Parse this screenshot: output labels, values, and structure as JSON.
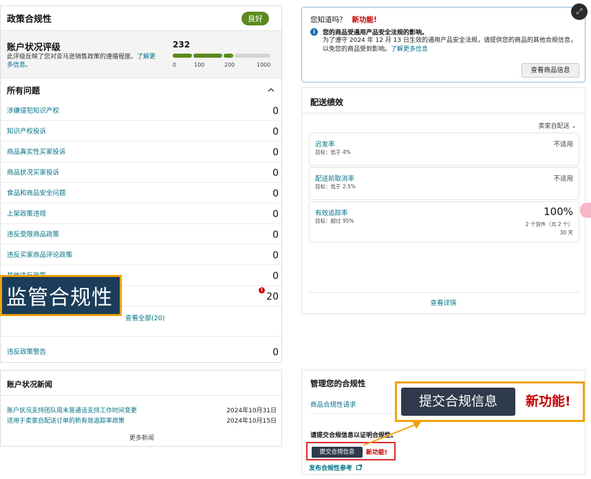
{
  "policy": {
    "title": "政策合规性",
    "badge": "良好",
    "health_title": "账户状况评级",
    "health_desc": "此评级反映了您对亚马逊销售政策的遵循程度。",
    "health_link": "了解更多信息。",
    "score": "232",
    "ticks": [
      "0",
      "100",
      "200",
      "1000"
    ],
    "issues_title": "所有问题",
    "issues": [
      {
        "label": "涉嫌侵犯知识产权",
        "count": "0"
      },
      {
        "label": "知识产权投诉",
        "count": "0"
      },
      {
        "label": "商品真实性买家投诉",
        "count": "0"
      },
      {
        "label": "商品状况买家投诉",
        "count": "0"
      },
      {
        "label": "食品和商品安全问题",
        "count": "0"
      },
      {
        "label": "上架政策违规",
        "count": "0"
      },
      {
        "label": "违反受限商品政策",
        "count": "0"
      },
      {
        "label": "违反买家商品评论政策",
        "count": "0"
      },
      {
        "label": "其他违反政策",
        "count": "0"
      }
    ],
    "regulatory_count": "20",
    "view_all": "查看全部(20)",
    "policy_warning_label": "违反政策警告",
    "policy_warning_count": "0"
  },
  "callout_regulatory": "监管合规性",
  "news": {
    "title": "账户状况新闻",
    "items": [
      {
        "text": "账户状况支持团队周末普通话支持工作时间变更",
        "date": "2024年10月31日"
      },
      {
        "text": "适用于卖家自配送订单的新有效追踪率政策",
        "date": "2024年10月15日"
      }
    ],
    "more": "更多新闻"
  },
  "did_you_know": {
    "title": "您知道吗？",
    "new_label": "新功能!",
    "bold": "您的商品受通用产品安全法规的影响。",
    "text": "为了遵守 2024 年 12 月 13 日生效的通用产品安全法规，请提供您的商品的其他合规信息，以免您的商品受到影响。",
    "link": "了解更多信息",
    "button": "查看商品信息"
  },
  "shipping": {
    "title": "配送绩效",
    "seller_select": "卖家自配送 ⌄",
    "metrics": [
      {
        "name": "迟发率",
        "target": "目标：低于 4%",
        "value": "不适用"
      },
      {
        "name": "配送前取消率",
        "target": "目标：低于 2.5%",
        "value": "不适用"
      },
      {
        "name": "有效追踪率",
        "target": "目标：超过 95%",
        "value": "100%",
        "sub1": "2 个货件（共 2 个）",
        "sub2": "30 天"
      }
    ],
    "view_details": "查看详情"
  },
  "manage": {
    "title": "管理您的合规性",
    "request": "商品合规性请求",
    "please": "请提交合规信息以证明合规性。",
    "submit": "提交合规信息",
    "new_label": "新功能!",
    "publish": "发布合规性参考"
  },
  "callout_submit": {
    "button": "提交合规信息",
    "new_label": "新功能!"
  },
  "colors": {
    "good": "#5b8a1f",
    "link": "#007185",
    "orange": "#f0a30a",
    "red": "#c40000",
    "dark_button": "#2f3b4c"
  }
}
